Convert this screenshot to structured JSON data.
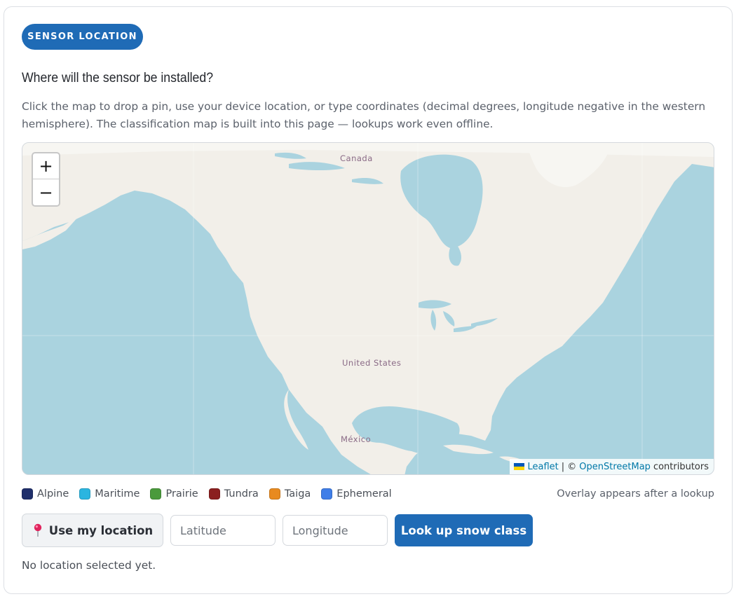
{
  "section_badge": "SENSOR LOCATION",
  "question": "Where will the sensor be installed?",
  "helper_text": "Click the map to drop a pin, use your device location, or type coordinates (decimal degrees, longitude negative in the western hemisphere). The classification map is built into this page — lookups work even offline.",
  "map": {
    "zoom_in_label": "+",
    "zoom_out_label": "−",
    "place_labels": {
      "canada": "Canada",
      "united_states": "United States",
      "mexico": "México"
    },
    "attribution": {
      "leaflet": "Leaflet",
      "separator": "| ©",
      "osm": "OpenStreetMap",
      "suffix": "contributors"
    },
    "colors": {
      "water": "#aad3df",
      "land": "#f2efe9",
      "ice": "#f7f6f2"
    }
  },
  "legend": [
    {
      "label": "Alpine",
      "color": "#1f2f6b"
    },
    {
      "label": "Maritime",
      "color": "#2bb5e0"
    },
    {
      "label": "Prairie",
      "color": "#4a9a3c"
    },
    {
      "label": "Tundra",
      "color": "#8b1f1f"
    },
    {
      "label": "Taiga",
      "color": "#e88a1f"
    },
    {
      "label": "Ephemeral",
      "color": "#3f7ee8"
    }
  ],
  "overlay_note": "Overlay appears after a lookup",
  "controls": {
    "use_location_label": "Use my location",
    "use_location_icon": "pin-icon",
    "latitude_placeholder": "Latitude",
    "longitude_placeholder": "Longitude",
    "lookup_label": "Look up snow class"
  },
  "status_text": "No location selected yet.",
  "colors": {
    "accent": "#1f6bb6"
  }
}
